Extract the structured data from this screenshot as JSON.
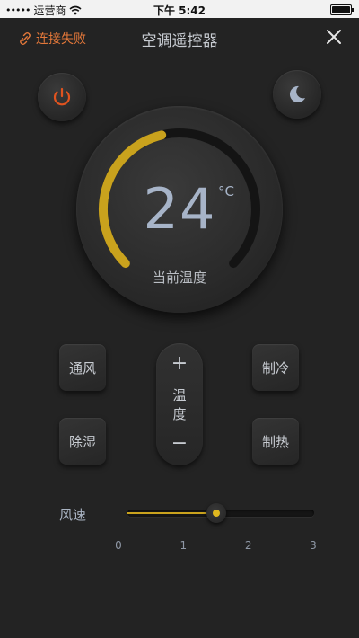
{
  "status_bar": {
    "carrier": "运营商",
    "time": "下午 5:42"
  },
  "nav": {
    "connection_status": "连接失败",
    "title": "空调遥控器"
  },
  "icons": {
    "power": "power-icon",
    "sleep": "moon-icon",
    "close": "close-icon",
    "link": "broken-link-icon"
  },
  "colors": {
    "accent": "#e0b81f",
    "power": "#e0531f",
    "warning": "#e4783a"
  },
  "dial": {
    "temperature": "24",
    "unit": "°C",
    "label": "当前温度",
    "progress": 0.45
  },
  "modes": {
    "fan": "通风",
    "dry": "除湿",
    "cool": "制冷",
    "heat": "制热"
  },
  "temp_control": {
    "plus": "+",
    "line1": "温",
    "line2": "度",
    "minus": "−"
  },
  "wind": {
    "label": "风速",
    "ticks": [
      "0",
      "1",
      "2",
      "3"
    ],
    "value": 1.5,
    "max": 3
  }
}
